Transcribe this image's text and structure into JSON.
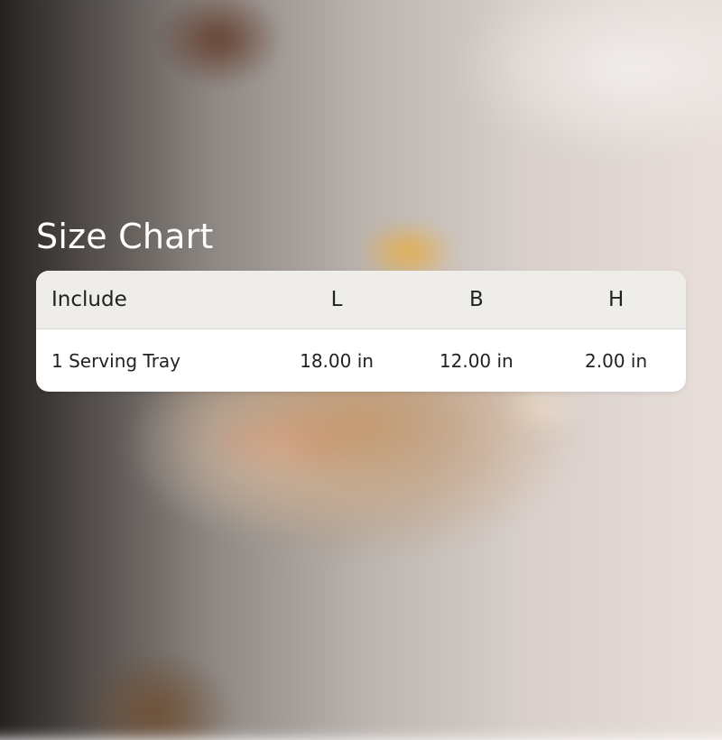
{
  "title": "Size Chart",
  "table": {
    "headers": [
      "Include",
      "L",
      "B",
      "H"
    ],
    "rows": [
      [
        "1 Serving Tray",
        "18.00 in",
        "12.00 in",
        "2.00 in"
      ]
    ]
  },
  "colors": {
    "header_bg": "#efede9",
    "card_bg": "#ffffff",
    "text": "#222222",
    "title": "#ffffff"
  }
}
